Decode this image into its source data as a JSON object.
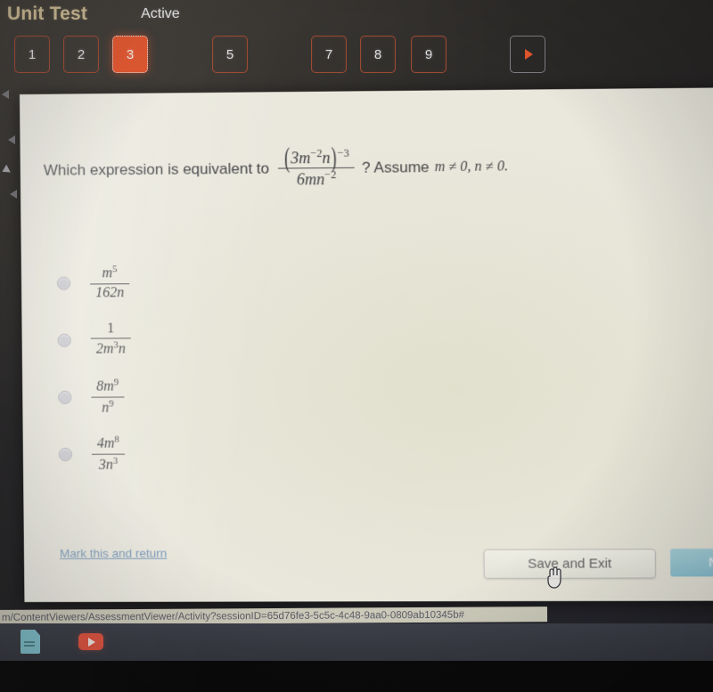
{
  "header": {
    "unit_title": "Unit Test",
    "status": "Active",
    "tabs": [
      {
        "label": "1",
        "state": "normal"
      },
      {
        "label": "2",
        "state": "normal"
      },
      {
        "label": "3",
        "state": "current"
      },
      {
        "label": "5",
        "state": "normal"
      },
      {
        "label": "7",
        "state": "normal"
      },
      {
        "label": "8",
        "state": "normal"
      },
      {
        "label": "9",
        "state": "normal"
      }
    ],
    "next_arrow_icon": "play-arrow-icon"
  },
  "question": {
    "lead_text": "Which expression is equivalent to",
    "expression": {
      "numerator_base": "3m",
      "numerator_base_exp": "−2",
      "numerator_var": "n",
      "outer_exponent": "−3",
      "denominator": "6mn",
      "denominator_exp": "−2"
    },
    "tail_text": "? Assume",
    "assumption": "m ≠ 0, n ≠ 0."
  },
  "choices": [
    {
      "id": "a",
      "numerator": "m",
      "numerator_exp": "5",
      "denominator": "162n",
      "denominator_exp": "",
      "selected": false
    },
    {
      "id": "b",
      "numerator": "1",
      "numerator_exp": "",
      "denominator": "2m",
      "denominator_exp": "3",
      "denominator_tail": "n",
      "selected": false
    },
    {
      "id": "c",
      "numerator": "8m",
      "numerator_exp": "9",
      "denominator": "n",
      "denominator_exp": "9",
      "selected": false
    },
    {
      "id": "d",
      "numerator": "4m",
      "numerator_exp": "8",
      "denominator": "3n",
      "denominator_exp": "3",
      "selected": false
    }
  ],
  "footer": {
    "mark_link": "Mark this and return",
    "save_button": "Save and Exit",
    "next_button": "Next"
  },
  "browser": {
    "url": "m/ContentViewers/AssessmentViewer/Activity?sessionID=65d76fe3-5c5c-4c48-9aa0-0809ab10345b#"
  },
  "taskbar": {
    "items": [
      {
        "icon": "document-icon"
      },
      {
        "icon": "youtube-icon"
      }
    ]
  },
  "colors": {
    "accent_orange": "#e2562e",
    "tab_border": "#9d4a33",
    "title_gold": "#cdbb94",
    "page_bg": "#eae8dd",
    "next_teal": "#8cc3d4",
    "link_blue": "#6f93b8"
  }
}
